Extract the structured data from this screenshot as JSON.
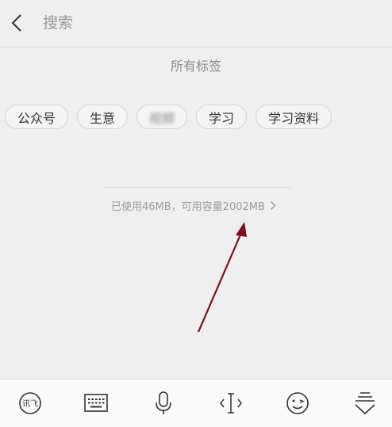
{
  "header": {
    "search_placeholder": "搜索"
  },
  "section": {
    "title": "所有标签"
  },
  "tags": [
    {
      "label": "公众号",
      "blurred": false
    },
    {
      "label": "生意",
      "blurred": false
    },
    {
      "label": "视频",
      "blurred": true
    },
    {
      "label": "学习",
      "blurred": false
    },
    {
      "label": "学习资料",
      "blurred": false
    }
  ],
  "storage": {
    "text": "已使用46MB，可用容量2002MB",
    "chevron": ">"
  },
  "keyboard_toolbar": {
    "ime_logo_text": "讯飞",
    "icons": [
      "ime-logo-icon",
      "keyboard-icon",
      "microphone-icon",
      "text-cursor-icon",
      "emoji-icon",
      "collapse-keyboard-icon"
    ]
  },
  "colors": {
    "background": "#efeff0",
    "annotation_arrow": "#7b1020",
    "muted_text": "#9c9c9c"
  }
}
